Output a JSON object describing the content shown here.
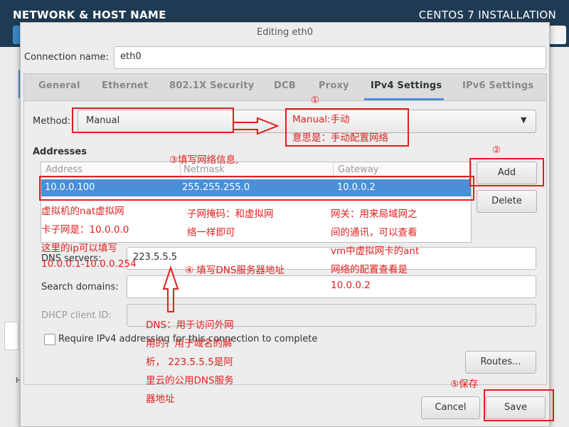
{
  "installer": {
    "section_title": "NETWORK & HOST NAME",
    "product_title": "CENTOS 7 INSTALLATION",
    "bg_letter": "H"
  },
  "dialog": {
    "title": "Editing eth0",
    "connection_name_label": "Connection name:",
    "connection_name_value": "eth0",
    "tabs": [
      {
        "label": "General"
      },
      {
        "label": "Ethernet"
      },
      {
        "label": "802.1X Security"
      },
      {
        "label": "DCB"
      },
      {
        "label": "Proxy"
      },
      {
        "label": "IPv4 Settings",
        "active": true
      },
      {
        "label": "IPv6 Settings"
      }
    ],
    "method_label": "Method:",
    "method_value": "Manual",
    "addresses_heading": "Addresses",
    "table": {
      "columns": [
        "Address",
        "Netmask",
        "Gateway"
      ],
      "rows": [
        [
          "10.0.0.100",
          "255.255.255.0",
          "10.0.0.2"
        ]
      ]
    },
    "add_label": "Add",
    "delete_label": "Delete",
    "dns_label": "DNS servers:",
    "dns_value": "223.5.5.5",
    "search_domains_label": "Search domains:",
    "search_domains_value": "",
    "dhcp_label": "DHCP client ID:",
    "dhcp_value": "",
    "require_ipv4_label": "Require IPv4 addressing for this connection to complete",
    "require_ipv4_checked": false,
    "routes_label": "Routes...",
    "cancel_label": "Cancel",
    "save_label": "Save"
  },
  "annotations": {
    "n1": "①",
    "manual_1": "Manual:手动",
    "manual_2": "意思是：手动配置网络",
    "n2": "②",
    "n3": "③填写网络信息,",
    "vm_1": "虚拟机的nat虚拟网",
    "vm_2": "卡子网是：10.0.0.0",
    "vm_3": "这里的ip可以填写",
    "vm_4": "10.0.0.1-10.0.0.254",
    "mask_1": "子网掩码：和虚拟网",
    "mask_2": "络一样即可",
    "gw_1": "网关：用来局域网之",
    "gw_2": "间的通讯，可以查看",
    "gw_3": "vm中虚拟网卡的ant",
    "gw_4": "网络的配置查看是",
    "gw_5": "10.0.0.2",
    "n4": "④ 填写DNS服务器地址",
    "dns_1": "DNS：用于访问外网",
    "dns_2": "用的，用于域名的解",
    "dns_3": "析， 223.5.5.5是阿",
    "dns_4": "里云的公用DNS服务",
    "dns_5": "器地址",
    "n5": "⑤保存"
  },
  "colors": {
    "header_bg": "#1f3b53",
    "selection": "#4a90d9",
    "annotation_red": "#e02020"
  }
}
